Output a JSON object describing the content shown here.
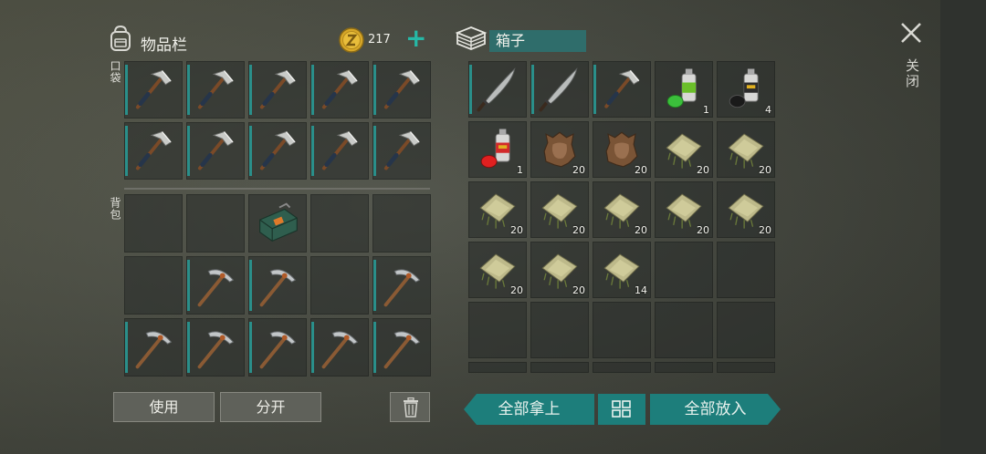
{
  "inventory": {
    "title": "物品栏",
    "coins": "217",
    "pocket_label": "口袋",
    "backpack_label": "背包",
    "pocket": [
      {
        "item": "hatchet",
        "stripe": true
      },
      {
        "item": "hatchet",
        "stripe": true
      },
      {
        "item": "hatchet",
        "stripe": true
      },
      {
        "item": "hatchet",
        "stripe": true
      },
      {
        "item": "hatchet",
        "stripe": true
      },
      {
        "item": "hatchet",
        "stripe": true
      },
      {
        "item": "hatchet",
        "stripe": true
      },
      {
        "item": "hatchet",
        "stripe": true
      },
      {
        "item": "hatchet",
        "stripe": true
      },
      {
        "item": "hatchet",
        "stripe": true
      }
    ],
    "backpack": [
      {
        "item": "",
        "stripe": false
      },
      {
        "item": "",
        "stripe": false
      },
      {
        "item": "toolbox",
        "stripe": false
      },
      {
        "item": "",
        "stripe": false
      },
      {
        "item": "",
        "stripe": false
      },
      {
        "item": "",
        "stripe": false
      },
      {
        "item": "pickaxe",
        "stripe": true
      },
      {
        "item": "pickaxe",
        "stripe": true
      },
      {
        "item": "",
        "stripe": false
      },
      {
        "item": "pickaxe",
        "stripe": true
      },
      {
        "item": "pickaxe",
        "stripe": true
      },
      {
        "item": "pickaxe",
        "stripe": true
      },
      {
        "item": "pickaxe",
        "stripe": true
      },
      {
        "item": "pickaxe",
        "stripe": true
      },
      {
        "item": "pickaxe",
        "stripe": true
      }
    ]
  },
  "chest": {
    "title": "箱子",
    "slots": [
      {
        "item": "machete",
        "qty": "",
        "stripe": true
      },
      {
        "item": "machete",
        "qty": "",
        "stripe": true
      },
      {
        "item": "hatchet",
        "qty": "",
        "stripe": true
      },
      {
        "item": "green-spray-can",
        "qty": "1",
        "stripe": false
      },
      {
        "item": "black-spray-can",
        "qty": "4",
        "stripe": false
      },
      {
        "item": "red-spray-can",
        "qty": "1",
        "stripe": false
      },
      {
        "item": "animal-hide",
        "qty": "20",
        "stripe": false
      },
      {
        "item": "animal-hide",
        "qty": "20",
        "stripe": false
      },
      {
        "item": "plant-fiber",
        "qty": "20",
        "stripe": false
      },
      {
        "item": "plant-fiber",
        "qty": "20",
        "stripe": false
      },
      {
        "item": "plant-fiber",
        "qty": "20",
        "stripe": false
      },
      {
        "item": "plant-fiber",
        "qty": "20",
        "stripe": false
      },
      {
        "item": "plant-fiber",
        "qty": "20",
        "stripe": false
      },
      {
        "item": "plant-fiber",
        "qty": "20",
        "stripe": false
      },
      {
        "item": "plant-fiber",
        "qty": "20",
        "stripe": false
      },
      {
        "item": "plant-fiber",
        "qty": "20",
        "stripe": false
      },
      {
        "item": "plant-fiber",
        "qty": "20",
        "stripe": false
      },
      {
        "item": "plant-fiber",
        "qty": "14",
        "stripe": false
      },
      {
        "item": "",
        "qty": "",
        "stripe": false
      },
      {
        "item": "",
        "qty": "",
        "stripe": false
      },
      {
        "item": "",
        "qty": "",
        "stripe": false
      },
      {
        "item": "",
        "qty": "",
        "stripe": false
      },
      {
        "item": "",
        "qty": "",
        "stripe": false
      },
      {
        "item": "",
        "qty": "",
        "stripe": false
      },
      {
        "item": "",
        "qty": "",
        "stripe": false
      },
      {
        "item": "",
        "qty": "",
        "stripe": false
      },
      {
        "item": "",
        "qty": "",
        "stripe": false
      },
      {
        "item": "",
        "qty": "",
        "stripe": false
      },
      {
        "item": "",
        "qty": "",
        "stripe": false
      },
      {
        "item": "",
        "qty": "",
        "stripe": false
      }
    ]
  },
  "buttons": {
    "use": "使用",
    "split": "分开",
    "take_all": "全部拿上",
    "put_all": "全部放入",
    "close": "关闭"
  },
  "colors": {
    "accent": "#1d7e7b",
    "stripe": "#2a8f8a",
    "plus": "#26b8a6"
  }
}
